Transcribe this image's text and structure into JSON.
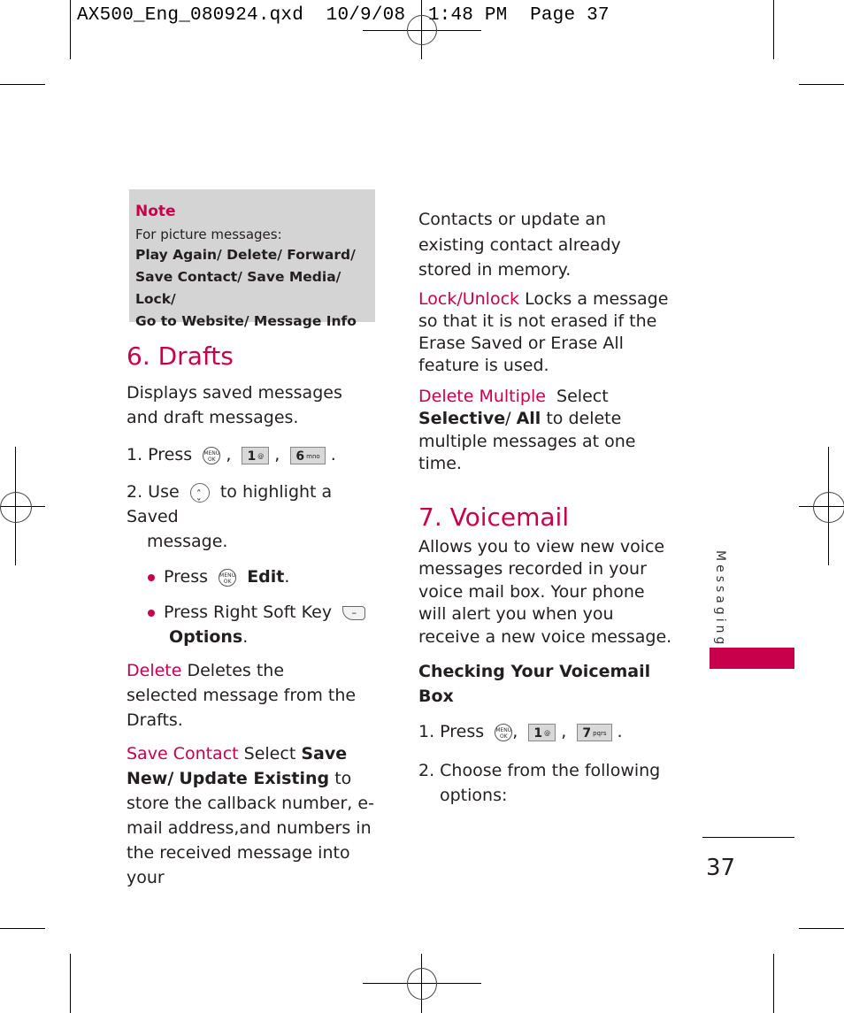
{
  "slug": "AX500_Eng_080924.qxd  10/9/08  1:48 PM  Page 37",
  "note": {
    "title": "Note",
    "intro": "For picture messages:",
    "lines": [
      "Play Again/ Delete/ Forward/",
      "Save Contact/ Save Media/ Lock/",
      "Go to Website/ Message Info"
    ]
  },
  "drafts": {
    "heading": "6. Drafts",
    "description": "Displays saved messages and draft messages.",
    "step1_prefix": "1. Press",
    "step2_prefix": "2. Use",
    "step2_suffix": "to highlight a Saved",
    "step2_cont": "message.",
    "bullet1_prefix": "Press",
    "bullet1_bold": "Edit",
    "bullet2_prefix": "Press Right Soft Key",
    "bullet2_bold": "Options",
    "delete_term": "Delete",
    "delete_desc": "Deletes the selected message from the Drafts.",
    "save_term": "Save Contact",
    "save_select": "Select",
    "save_bold1": "Save New/",
    "save_bold2": "Update Existing",
    "save_desc": "to store the callback number, e-mail address,and numbers in the received message into your"
  },
  "right_col": {
    "continued": "Contacts or update an existing contact already stored in memory.",
    "lock_term": "Lock/Unlock",
    "lock_desc": "Locks a message so that it is not erased if the Erase Saved or Erase All feature is used.",
    "multi_term": "Delete Multiple",
    "multi_select": "Select",
    "multi_bold1": "Selective",
    "multi_bold2": "All",
    "multi_desc": "to delete multiple messages at one time."
  },
  "voicemail": {
    "heading": "7. Voicemail",
    "description": "Allows you to view new voice messages recorded in your voice mail box. Your phone will alert you when you receive a new voice message.",
    "subheading": "Checking Your Voicemail Box",
    "step1_prefix": "1. Press",
    "step2": "2. Choose from the following",
    "step2_cont": "options:"
  },
  "keys": {
    "menu_top": "MENU",
    "menu_bottom": "OK",
    "key1": "1",
    "key1_sub": "@",
    "key6": "6",
    "key6_sub": "mno",
    "key7": "7",
    "key7_sub": "pqrs",
    "soft_glyph": "–"
  },
  "sidetab": {
    "label": "Messaging",
    "color": "#c8004b"
  },
  "page_number": "37"
}
